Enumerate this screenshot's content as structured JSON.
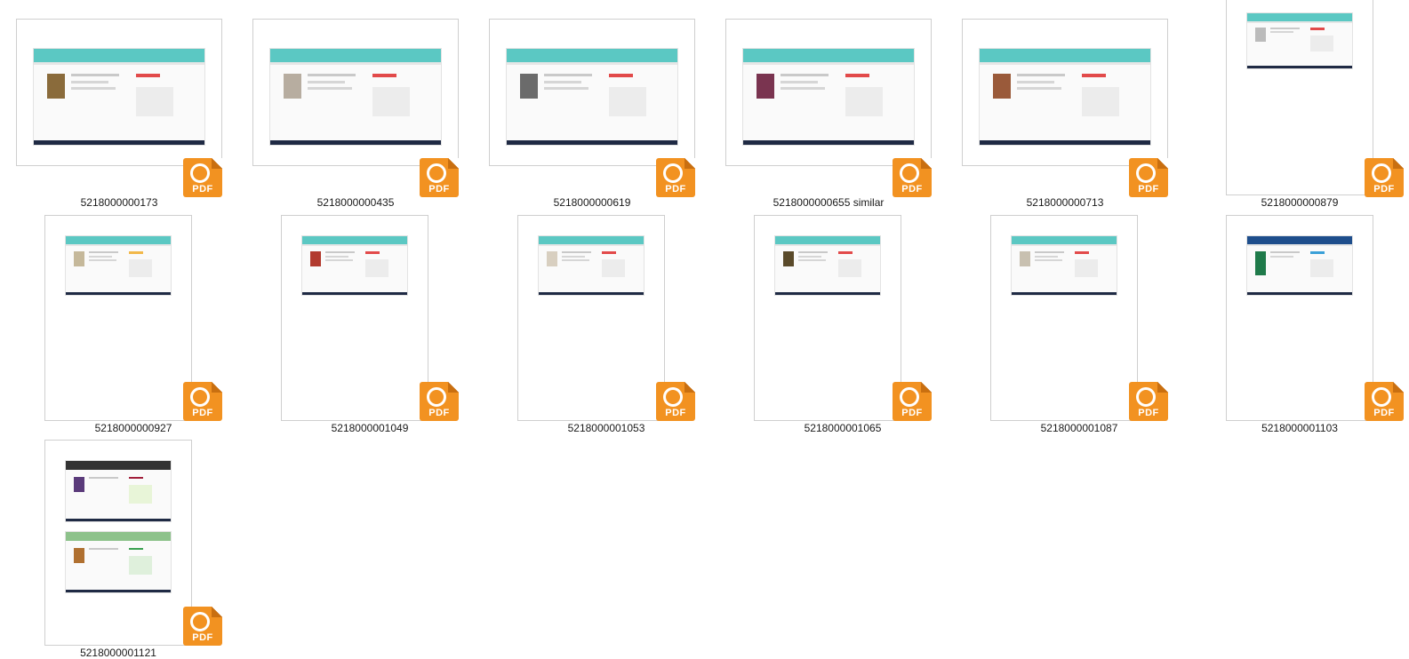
{
  "files": [
    {
      "name": "5218000000173",
      "type": "PDF"
    },
    {
      "name": "5218000000435",
      "type": "PDF"
    },
    {
      "name": "5218000000619",
      "type": "PDF"
    },
    {
      "name": "5218000000655 similar",
      "type": "PDF"
    },
    {
      "name": "5218000000713",
      "type": "PDF"
    },
    {
      "name": "5218000000879",
      "type": "PDF"
    },
    {
      "name": "5218000000927",
      "type": "PDF"
    },
    {
      "name": "5218000001049",
      "type": "PDF"
    },
    {
      "name": "5218000001053",
      "type": "PDF"
    },
    {
      "name": "5218000001065",
      "type": "PDF"
    },
    {
      "name": "5218000001087",
      "type": "PDF"
    },
    {
      "name": "5218000001103",
      "type": "PDF"
    },
    {
      "name": "5218000001121",
      "type": "PDF"
    }
  ],
  "icons": {
    "file_type_badge": "foxit-pdf-icon",
    "badge_color": "#f29221"
  }
}
